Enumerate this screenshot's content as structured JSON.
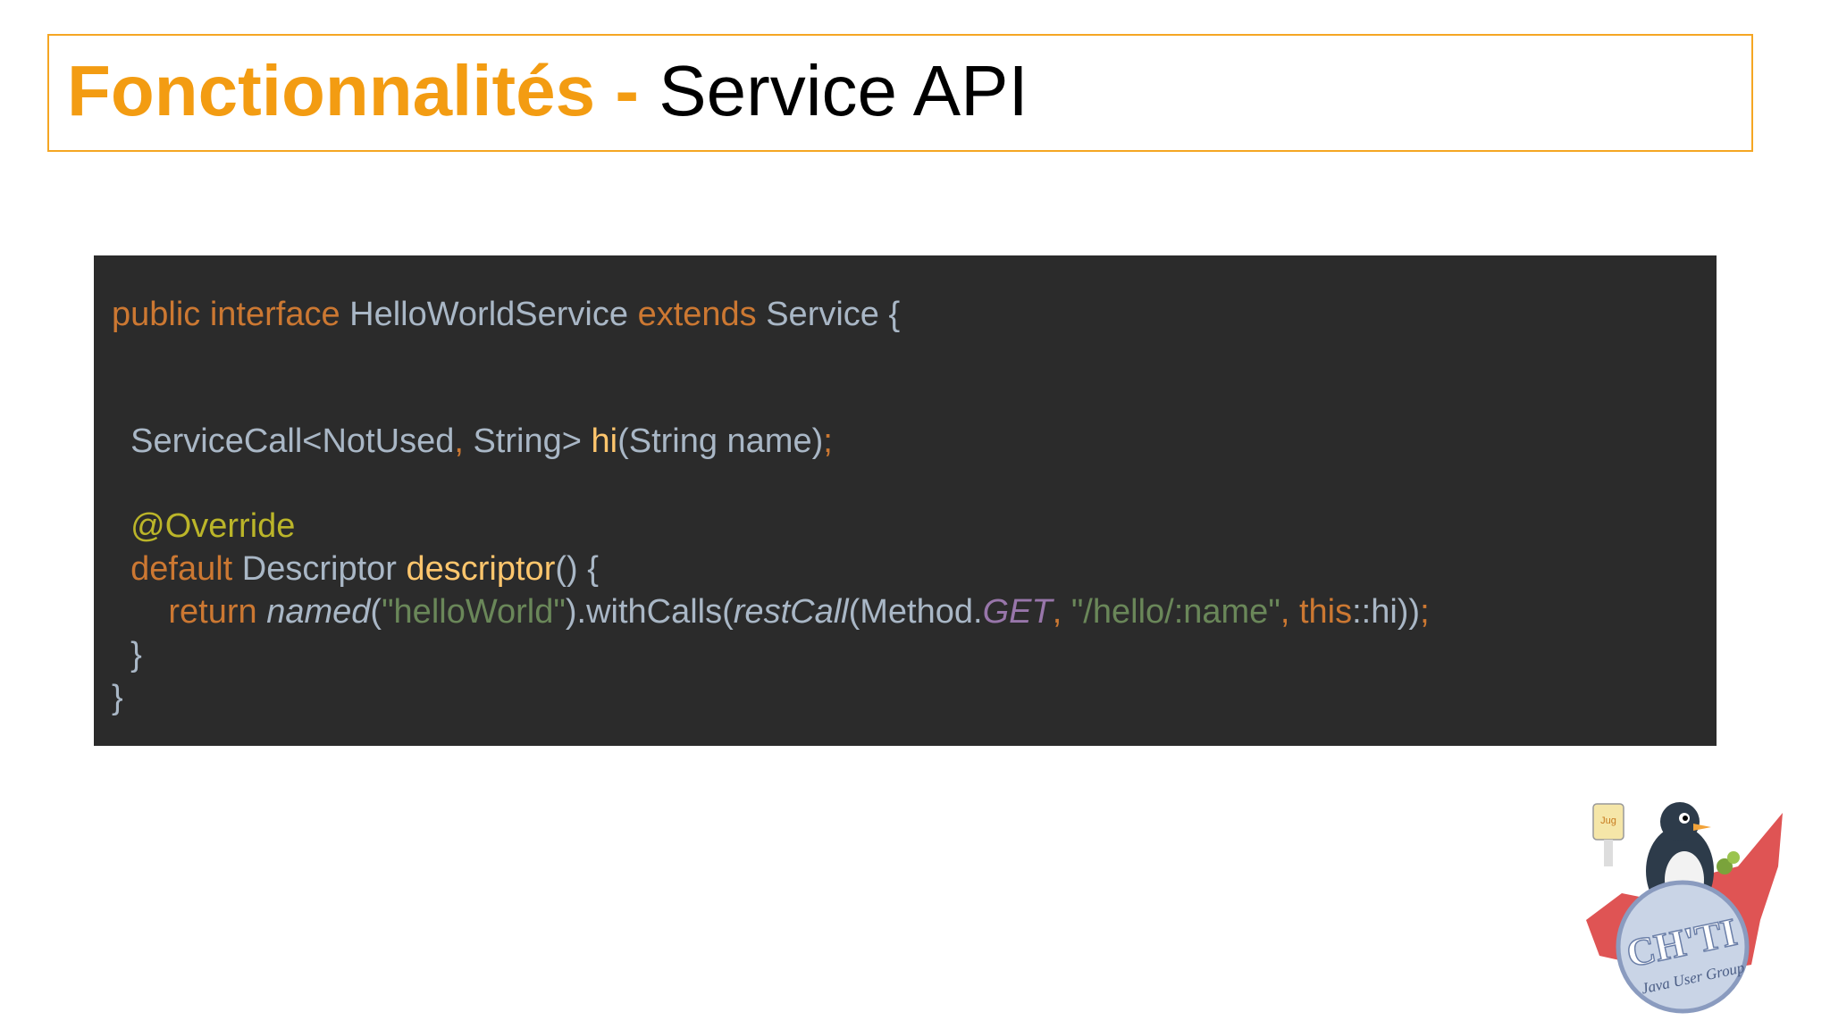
{
  "slide": {
    "title_accent": "Fonctionnalités -",
    "title_main": "Service API"
  },
  "code": {
    "line1": {
      "public_interface": "public interface",
      "class_name": " HelloWorldService ",
      "extends": "extends",
      "parent": " Service {"
    },
    "line2": {
      "indent": "  ",
      "type": "ServiceCall<NotUsed",
      "comma": ",",
      "type2": " String> ",
      "method": "hi",
      "params": "(String name)",
      "semi": ";"
    },
    "line3": {
      "indent": "  ",
      "annotation": "@Override"
    },
    "line4": {
      "indent": "  ",
      "default": "default",
      "type": " Descriptor ",
      "method": "descriptor",
      "rest": "() {"
    },
    "line5": {
      "indent": "      ",
      "return": "return",
      "space": " ",
      "named": "named",
      "open": "(",
      "str1": "\"helloWorld\"",
      "with": ").withCalls(",
      "restcall": "restCall",
      "method_open": "(Method.",
      "get": "GET",
      "comma1": ", ",
      "str2": "\"/hello/:name\"",
      "comma2": ", ",
      "this": "this",
      "ref": "::hi))",
      "semi": ";"
    },
    "line6": {
      "brace": "  }"
    },
    "line7": {
      "brace": "}"
    }
  },
  "logo": {
    "text_main": "CH'TI",
    "text_sub": "Java User Group",
    "badge": "Jug"
  },
  "colors": {
    "title_accent": "#f39c12",
    "title_border": "#f5a623",
    "code_bg": "#2b2b2b",
    "keyword": "#cc7832",
    "function": "#ffc66d",
    "annotation": "#bbb529",
    "string": "#6a8759",
    "constant": "#9876aa",
    "default_text": "#a9b7c6"
  }
}
